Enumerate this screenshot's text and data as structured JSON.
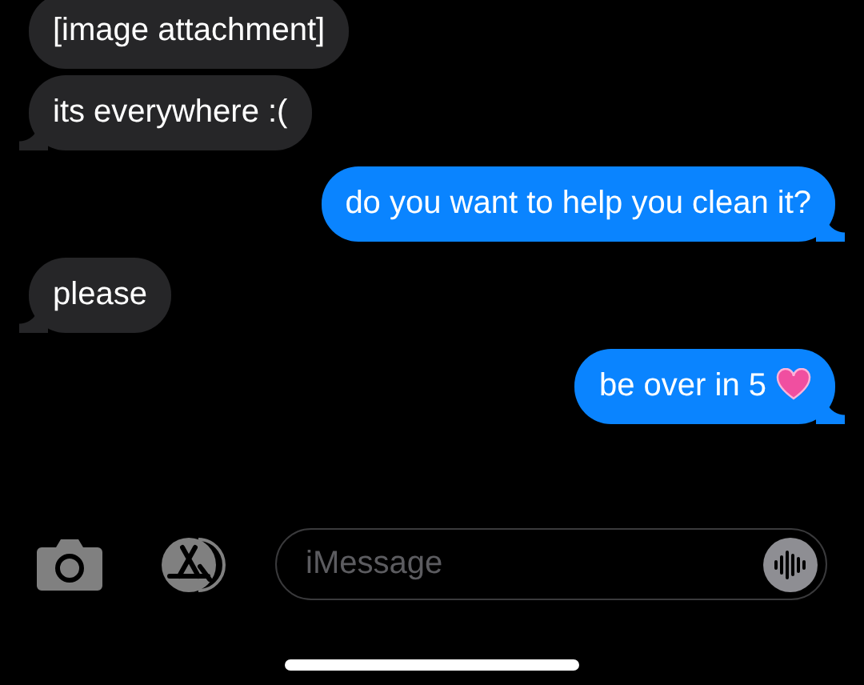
{
  "messages": [
    {
      "kind": "incoming",
      "text": "[image attachment]",
      "tail": false,
      "heart": false
    },
    {
      "kind": "incoming",
      "text": "its everywhere :(",
      "tail": true,
      "heart": false
    },
    {
      "kind": "outgoing",
      "text": "do you want to help you clean it?",
      "tail": true,
      "heart": false
    },
    {
      "kind": "incoming",
      "text": "please",
      "tail": true,
      "heart": false
    },
    {
      "kind": "outgoing",
      "text": "be over in 5",
      "tail": true,
      "heart": true
    }
  ],
  "composer": {
    "placeholder": "iMessage"
  }
}
